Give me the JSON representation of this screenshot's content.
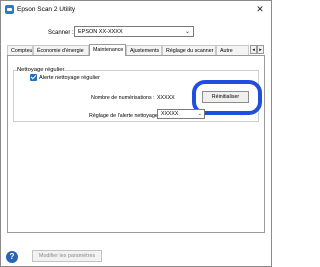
{
  "window": {
    "title": "Epson Scan 2 Utility",
    "close_glyph": "✕",
    "app_icon": "epson-scan-icon"
  },
  "scanner": {
    "label": "Scanner :",
    "value": "EPSON XX-XXXX"
  },
  "tabs": [
    {
      "label": "Compteur",
      "active": false
    },
    {
      "label": "Économie d'énergie",
      "active": false
    },
    {
      "label": "Maintenance",
      "active": true
    },
    {
      "label": "Ajustements",
      "active": false
    },
    {
      "label": "Réglage du scanner",
      "active": false
    },
    {
      "label": "Autre",
      "active": false
    }
  ],
  "tab_scroll": {
    "left_glyph": "◂",
    "right_glyph": "▸"
  },
  "maintenance": {
    "group_title": "Nettoyage régulier",
    "checkbox_label": "Alerte nettoyage régulier",
    "checkbox_checked": true,
    "scan_count_label": "Nombre de numérisations :",
    "scan_count_value": "XXXXX",
    "reset_button": "Réinitialiser",
    "alert_setting_label": "Réglage de l'alerte nettoyage :",
    "alert_setting_value": "XXXXX",
    "chevron_glyph": "⌄"
  },
  "footer": {
    "help_glyph": "?",
    "modify_button": "Modifier les paramètres"
  },
  "colors": {
    "highlight": "#1f4fe0",
    "checkbox": "#1f6fc1",
    "help": "#2a63b8"
  }
}
